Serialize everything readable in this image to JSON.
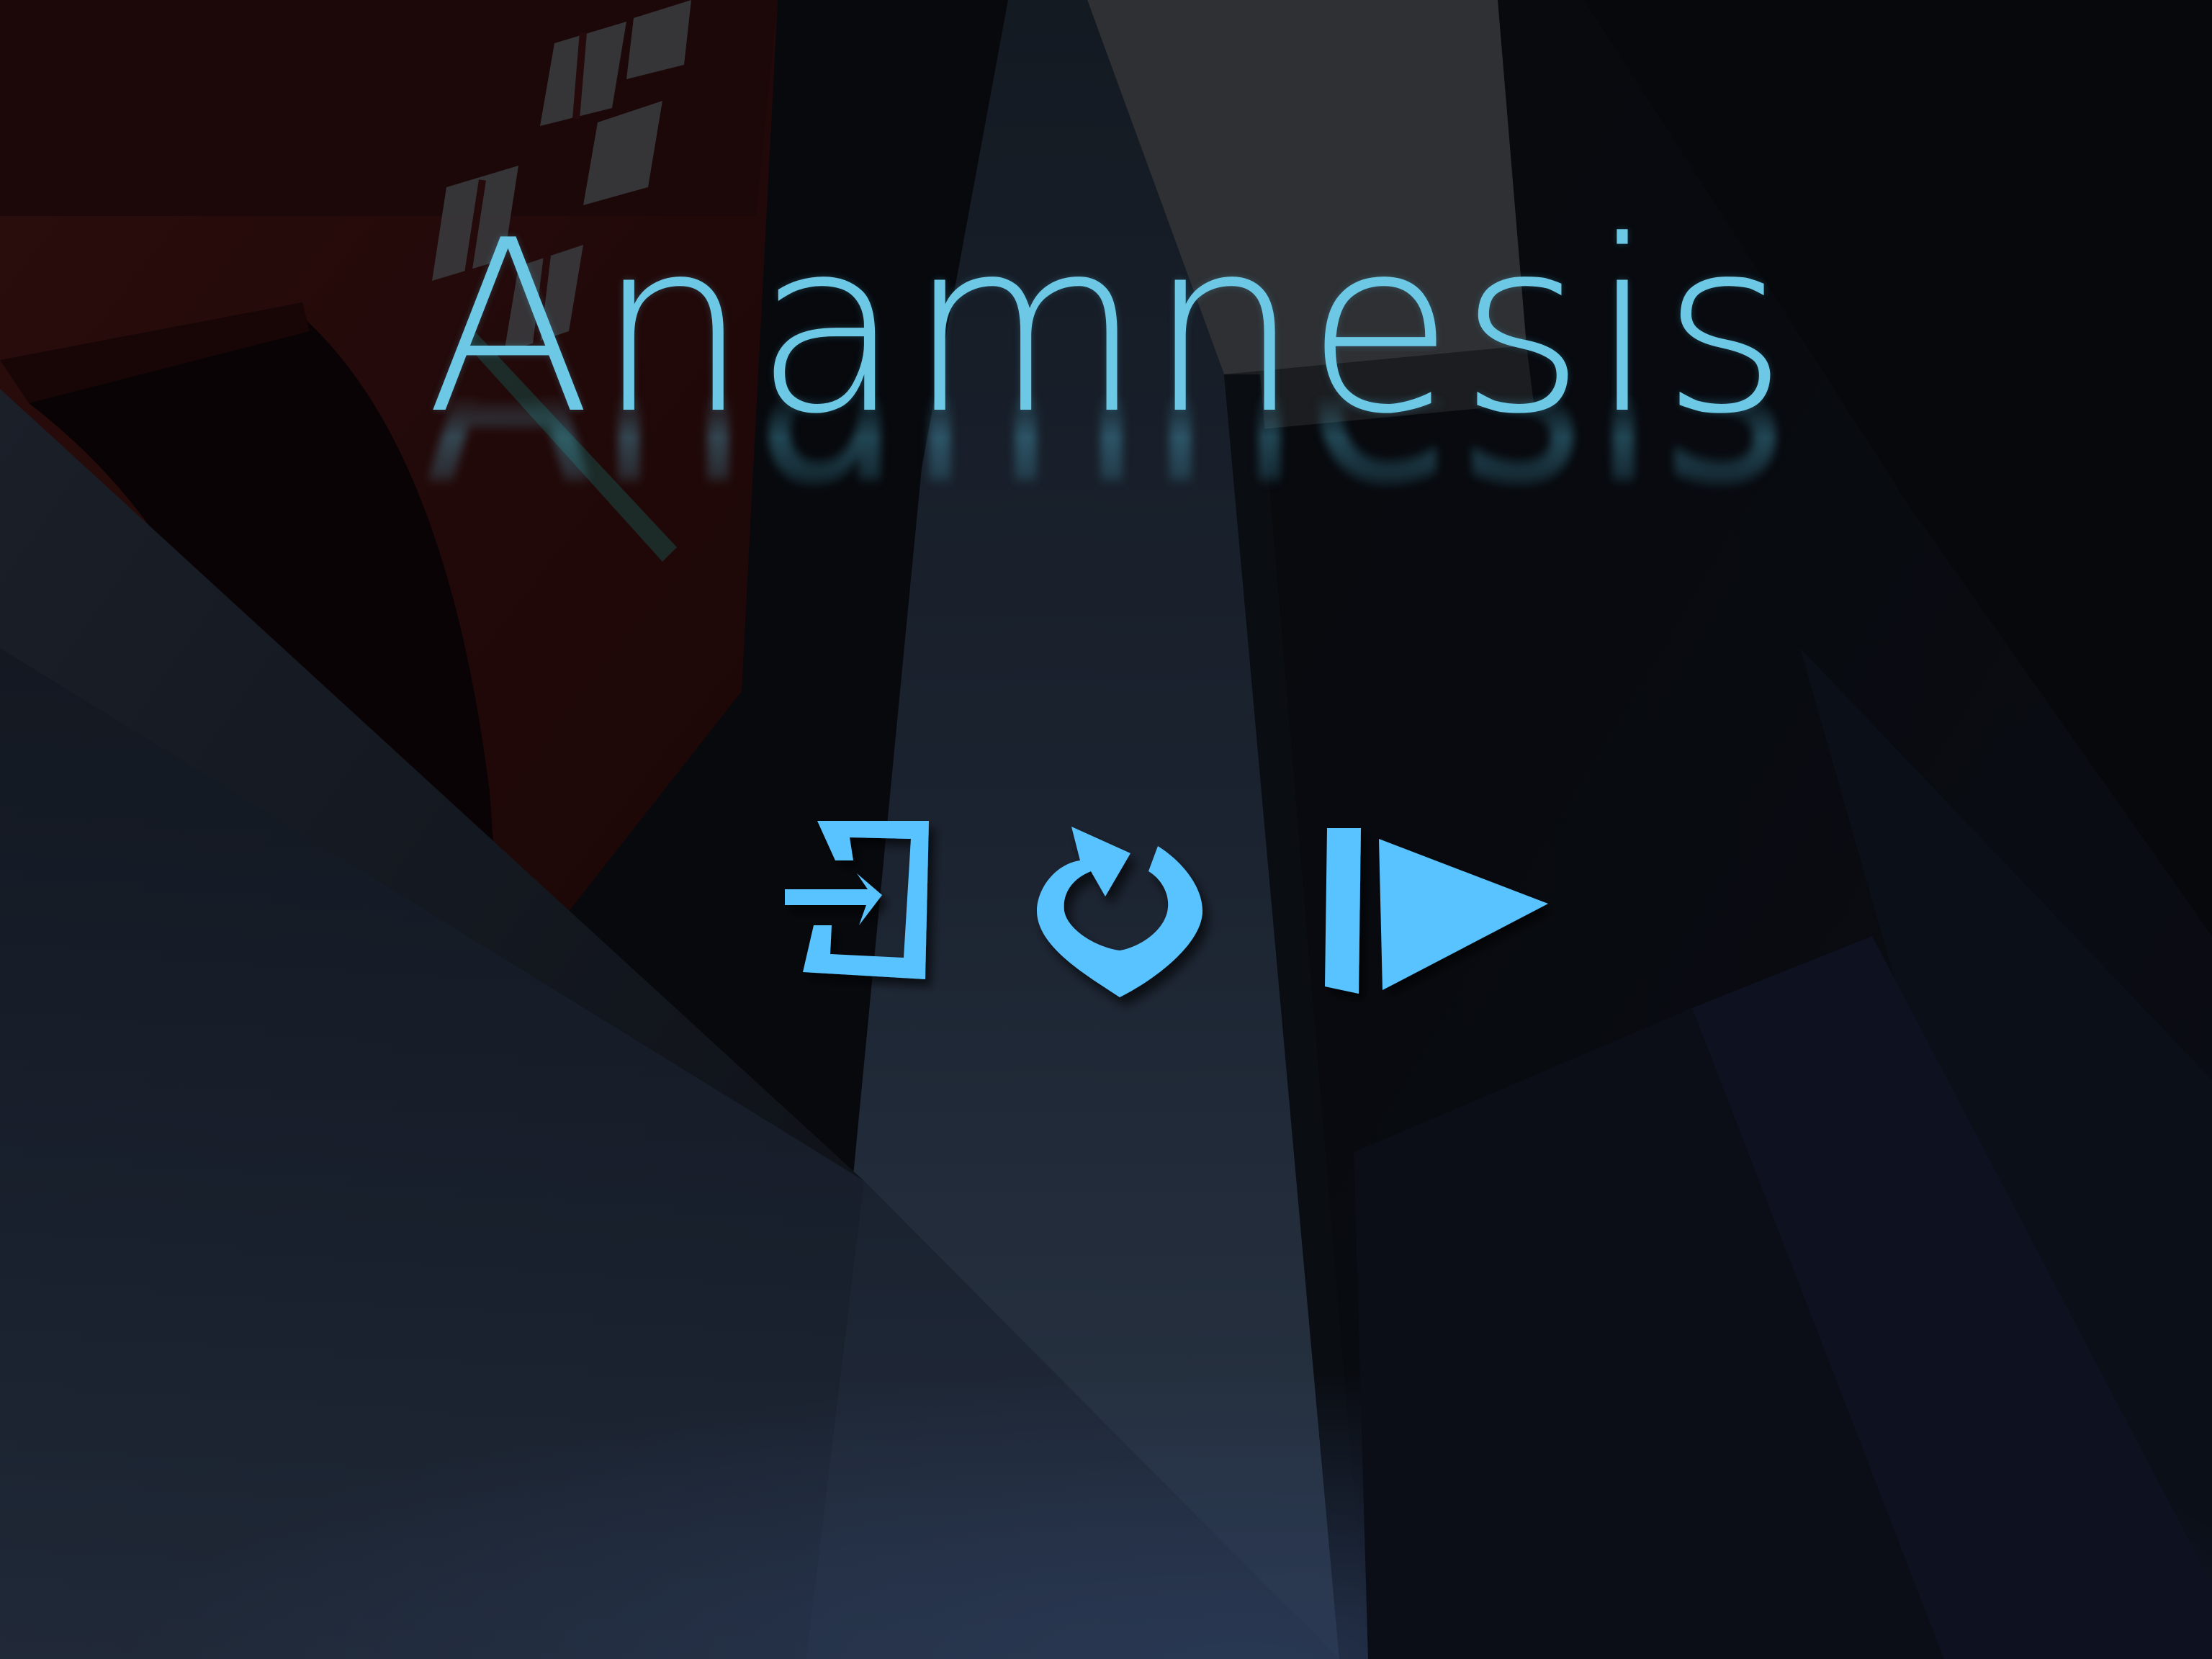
{
  "game": {
    "title": "Anamnesis"
  },
  "colors": {
    "accent": "#59c3ff",
    "title": "#6cc8e4",
    "background": "#050608",
    "wall_red": "#2a0c0c"
  },
  "menu": {
    "buttons": [
      {
        "id": "exit",
        "icon": "exit-door-icon",
        "label": ""
      },
      {
        "id": "restart",
        "icon": "restart-arrow-icon",
        "label": ""
      },
      {
        "id": "resume",
        "icon": "resume-play-icon",
        "label": ""
      }
    ]
  }
}
